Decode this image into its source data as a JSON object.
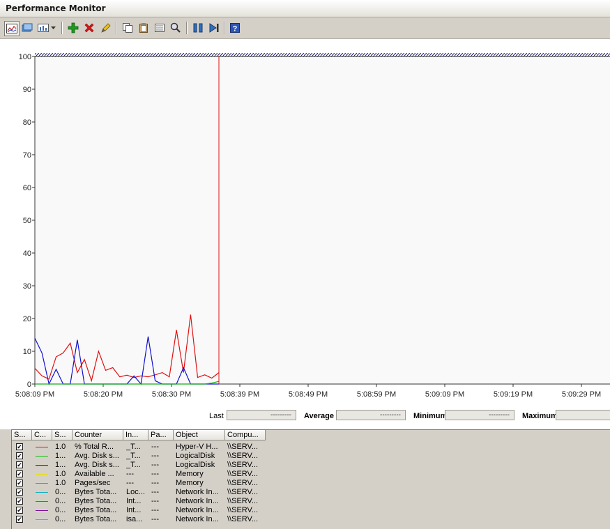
{
  "window": {
    "title": "Performance Monitor"
  },
  "toolbar": {
    "buttons": [
      {
        "icon": "view-graph-icon"
      },
      {
        "icon": "view-histogram-icon"
      },
      {
        "icon": "change-graph-type-icon"
      },
      {
        "icon": "dropdown-arrow-icon"
      },
      {
        "icon": "add-counter-icon"
      },
      {
        "icon": "delete-counter-icon"
      },
      {
        "icon": "highlight-icon"
      },
      {
        "icon": "copy-properties-icon"
      },
      {
        "icon": "paste-counter-list-icon"
      },
      {
        "icon": "properties-icon"
      },
      {
        "icon": "zoom-icon"
      },
      {
        "icon": "freeze-display-icon"
      },
      {
        "icon": "update-data-icon"
      },
      {
        "icon": "help-icon"
      }
    ],
    "colors": {
      "add": "#1f9a1f",
      "delete": "#d21a1a",
      "help": "#2e56b8"
    }
  },
  "chart_data": {
    "type": "line",
    "ylim": [
      0,
      100
    ],
    "yticks": [
      "100",
      "90",
      "80",
      "70",
      "60",
      "50",
      "40",
      "30",
      "20",
      "10",
      "0"
    ],
    "xticks": [
      "5:08:09 PM",
      "5:08:20 PM",
      "5:08:30 PM",
      "5:08:39 PM",
      "5:08:49 PM",
      "5:08:59 PM",
      "5:09:09 PM",
      "5:09:19 PM",
      "5:09:29 PM"
    ],
    "cursor_fraction": 0.32,
    "series": [
      {
        "color": "#e01010",
        "values": [
          4.8,
          2.5,
          1.5,
          8.3,
          9.5,
          12.5,
          3.5,
          7.5,
          1.0,
          10.0,
          4.2,
          5.0,
          2.2,
          2.7,
          2.0,
          2.5,
          2.2,
          2.8,
          3.5,
          2.2,
          16.5,
          3.5,
          21.2,
          2.0,
          2.8,
          1.8,
          3.5
        ]
      },
      {
        "color": "#1010d0",
        "values": [
          14.0,
          9.5,
          0.0,
          4.5,
          0.0,
          0.0,
          13.5,
          0.0,
          0.0,
          0.0,
          0.0,
          0.0,
          0.0,
          0.0,
          2.5,
          0.0,
          14.5,
          1.0,
          0.0,
          0.0,
          0.0,
          5.0,
          0.0,
          0.0,
          0.0,
          0.0,
          0.0
        ]
      },
      {
        "color": "#10b010",
        "values": [
          0,
          0,
          0,
          0,
          0,
          0,
          0,
          0,
          0,
          0,
          0,
          0,
          0,
          0,
          0,
          0,
          0,
          0,
          0,
          0,
          0,
          0,
          0,
          0,
          0,
          0.3,
          0.8
        ]
      }
    ]
  },
  "stats": {
    "last_label": "Last",
    "last_value": "---------",
    "average_label": "Average",
    "average_value": "---------",
    "minimum_label": "Minimum",
    "minimum_value": "---------",
    "maximum_label": "Maximum",
    "maximum_value": ""
  },
  "legend": {
    "headers": [
      "S...",
      "C...",
      "S...",
      "Counter",
      "In...",
      "Pa...",
      "Object",
      "Compu..."
    ],
    "rows": [
      {
        "color": "#e01010",
        "scale": "1.0",
        "counter": "% Total R...",
        "instance": "_T...",
        "parent": "---",
        "object": "Hyper-V H...",
        "computer": "\\\\SERV..."
      },
      {
        "color": "#10c010",
        "scale": "1...",
        "counter": "Avg. Disk s...",
        "instance": "_T...",
        "parent": "---",
        "object": "LogicalDisk",
        "computer": "\\\\SERV..."
      },
      {
        "color": "#1010d0",
        "scale": "1...",
        "counter": "Avg. Disk s...",
        "instance": "_T...",
        "parent": "---",
        "object": "LogicalDisk",
        "computer": "\\\\SERV..."
      },
      {
        "color": "#e8e000",
        "scale": "1.0",
        "counter": "Available ...",
        "instance": "---",
        "parent": "---",
        "object": "Memory",
        "computer": "\\\\SERV..."
      },
      {
        "color": "#b07070",
        "scale": "1.0",
        "counter": "Pages/sec",
        "instance": "---",
        "parent": "---",
        "object": "Memory",
        "computer": "\\\\SERV..."
      },
      {
        "color": "#10b0c0",
        "scale": "0...",
        "counter": "Bytes Tota...",
        "instance": "Loc...",
        "parent": "---",
        "object": "Network In...",
        "computer": "\\\\SERV..."
      },
      {
        "color": "#e010e0",
        "scale": "0...",
        "counter": "Bytes Tota...",
        "instance": "Int...",
        "parent": "---",
        "object": "Network In...",
        "computer": "\\\\SERV..."
      },
      {
        "color": "#8010a0",
        "scale": "0...",
        "counter": "Bytes Tota...",
        "instance": "Int...",
        "parent": "---",
        "object": "Network In...",
        "computer": "\\\\SERV..."
      },
      {
        "color": "#b0a020",
        "scale": "0...",
        "counter": "Bytes Tota...",
        "instance": "isa...",
        "parent": "---",
        "object": "Network In...",
        "computer": "\\\\SERV..."
      }
    ]
  }
}
